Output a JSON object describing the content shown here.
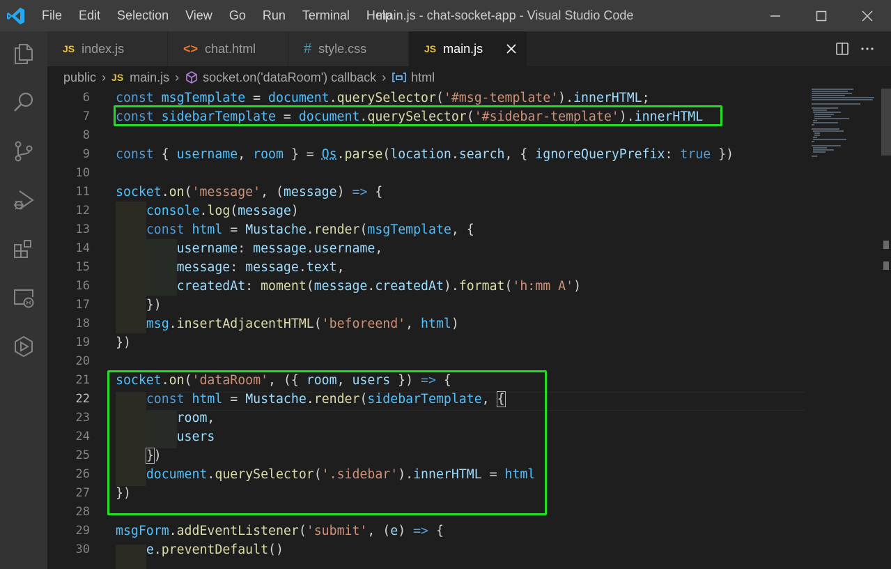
{
  "window": {
    "title": "main.js - chat-socket-app - Visual Studio Code"
  },
  "menu": [
    "File",
    "Edit",
    "Selection",
    "View",
    "Go",
    "Run",
    "Terminal",
    "Help"
  ],
  "tabs": [
    {
      "label": "index.js",
      "icon": "JS",
      "icon_name": "javascript-file-icon"
    },
    {
      "label": "chat.html",
      "icon": "<>",
      "icon_name": "html-file-icon"
    },
    {
      "label": "style.css",
      "icon": "#",
      "icon_name": "css-file-icon"
    },
    {
      "label": "main.js",
      "icon": "JS",
      "icon_name": "javascript-file-icon",
      "active": true
    }
  ],
  "breadcrumb": {
    "folder": "public",
    "file_icon": "JS",
    "file": "main.js",
    "symbol": "socket.on('dataRoom') callback",
    "variable": "html"
  },
  "editor": {
    "current_line": 22,
    "highlight_color": "#22dd22",
    "line_numbers": [
      "6",
      "7",
      "8",
      "9",
      "10",
      "11",
      "12",
      "13",
      "14",
      "15",
      "16",
      "17",
      "18",
      "19",
      "20",
      "21",
      "22",
      "23",
      "24",
      "25",
      "26",
      "27",
      "28",
      "29",
      "30"
    ]
  },
  "colors": {
    "keyword": "#569cd6",
    "variable": "#4fc1ff",
    "property": "#9cdcfe",
    "function": "#dcdcaa",
    "string": "#ce9178",
    "title_bar": "#3c3c3c",
    "activity_bar": "#333333",
    "editor_bg": "#1e1e1e"
  },
  "activity_icons": [
    "explorer-icon",
    "search-icon",
    "source-control-icon",
    "run-debug-icon",
    "extensions-icon",
    "remote-explorer-icon",
    "live-share-icon"
  ]
}
